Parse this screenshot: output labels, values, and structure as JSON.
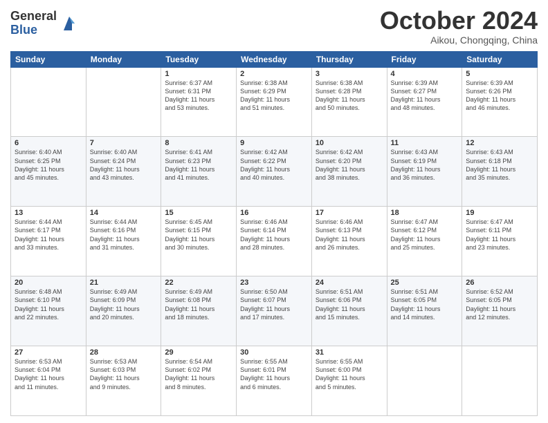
{
  "header": {
    "logo_line1": "General",
    "logo_line2": "Blue",
    "month_title": "October 2024",
    "location": "Aikou, Chongqing, China"
  },
  "calendar": {
    "weekdays": [
      "Sunday",
      "Monday",
      "Tuesday",
      "Wednesday",
      "Thursday",
      "Friday",
      "Saturday"
    ],
    "weeks": [
      [
        {
          "day": "",
          "info": ""
        },
        {
          "day": "",
          "info": ""
        },
        {
          "day": "1",
          "info": "Sunrise: 6:37 AM\nSunset: 6:31 PM\nDaylight: 11 hours\nand 53 minutes."
        },
        {
          "day": "2",
          "info": "Sunrise: 6:38 AM\nSunset: 6:29 PM\nDaylight: 11 hours\nand 51 minutes."
        },
        {
          "day": "3",
          "info": "Sunrise: 6:38 AM\nSunset: 6:28 PM\nDaylight: 11 hours\nand 50 minutes."
        },
        {
          "day": "4",
          "info": "Sunrise: 6:39 AM\nSunset: 6:27 PM\nDaylight: 11 hours\nand 48 minutes."
        },
        {
          "day": "5",
          "info": "Sunrise: 6:39 AM\nSunset: 6:26 PM\nDaylight: 11 hours\nand 46 minutes."
        }
      ],
      [
        {
          "day": "6",
          "info": "Sunrise: 6:40 AM\nSunset: 6:25 PM\nDaylight: 11 hours\nand 45 minutes."
        },
        {
          "day": "7",
          "info": "Sunrise: 6:40 AM\nSunset: 6:24 PM\nDaylight: 11 hours\nand 43 minutes."
        },
        {
          "day": "8",
          "info": "Sunrise: 6:41 AM\nSunset: 6:23 PM\nDaylight: 11 hours\nand 41 minutes."
        },
        {
          "day": "9",
          "info": "Sunrise: 6:42 AM\nSunset: 6:22 PM\nDaylight: 11 hours\nand 40 minutes."
        },
        {
          "day": "10",
          "info": "Sunrise: 6:42 AM\nSunset: 6:20 PM\nDaylight: 11 hours\nand 38 minutes."
        },
        {
          "day": "11",
          "info": "Sunrise: 6:43 AM\nSunset: 6:19 PM\nDaylight: 11 hours\nand 36 minutes."
        },
        {
          "day": "12",
          "info": "Sunrise: 6:43 AM\nSunset: 6:18 PM\nDaylight: 11 hours\nand 35 minutes."
        }
      ],
      [
        {
          "day": "13",
          "info": "Sunrise: 6:44 AM\nSunset: 6:17 PM\nDaylight: 11 hours\nand 33 minutes."
        },
        {
          "day": "14",
          "info": "Sunrise: 6:44 AM\nSunset: 6:16 PM\nDaylight: 11 hours\nand 31 minutes."
        },
        {
          "day": "15",
          "info": "Sunrise: 6:45 AM\nSunset: 6:15 PM\nDaylight: 11 hours\nand 30 minutes."
        },
        {
          "day": "16",
          "info": "Sunrise: 6:46 AM\nSunset: 6:14 PM\nDaylight: 11 hours\nand 28 minutes."
        },
        {
          "day": "17",
          "info": "Sunrise: 6:46 AM\nSunset: 6:13 PM\nDaylight: 11 hours\nand 26 minutes."
        },
        {
          "day": "18",
          "info": "Sunrise: 6:47 AM\nSunset: 6:12 PM\nDaylight: 11 hours\nand 25 minutes."
        },
        {
          "day": "19",
          "info": "Sunrise: 6:47 AM\nSunset: 6:11 PM\nDaylight: 11 hours\nand 23 minutes."
        }
      ],
      [
        {
          "day": "20",
          "info": "Sunrise: 6:48 AM\nSunset: 6:10 PM\nDaylight: 11 hours\nand 22 minutes."
        },
        {
          "day": "21",
          "info": "Sunrise: 6:49 AM\nSunset: 6:09 PM\nDaylight: 11 hours\nand 20 minutes."
        },
        {
          "day": "22",
          "info": "Sunrise: 6:49 AM\nSunset: 6:08 PM\nDaylight: 11 hours\nand 18 minutes."
        },
        {
          "day": "23",
          "info": "Sunrise: 6:50 AM\nSunset: 6:07 PM\nDaylight: 11 hours\nand 17 minutes."
        },
        {
          "day": "24",
          "info": "Sunrise: 6:51 AM\nSunset: 6:06 PM\nDaylight: 11 hours\nand 15 minutes."
        },
        {
          "day": "25",
          "info": "Sunrise: 6:51 AM\nSunset: 6:05 PM\nDaylight: 11 hours\nand 14 minutes."
        },
        {
          "day": "26",
          "info": "Sunrise: 6:52 AM\nSunset: 6:05 PM\nDaylight: 11 hours\nand 12 minutes."
        }
      ],
      [
        {
          "day": "27",
          "info": "Sunrise: 6:53 AM\nSunset: 6:04 PM\nDaylight: 11 hours\nand 11 minutes."
        },
        {
          "day": "28",
          "info": "Sunrise: 6:53 AM\nSunset: 6:03 PM\nDaylight: 11 hours\nand 9 minutes."
        },
        {
          "day": "29",
          "info": "Sunrise: 6:54 AM\nSunset: 6:02 PM\nDaylight: 11 hours\nand 8 minutes."
        },
        {
          "day": "30",
          "info": "Sunrise: 6:55 AM\nSunset: 6:01 PM\nDaylight: 11 hours\nand 6 minutes."
        },
        {
          "day": "31",
          "info": "Sunrise: 6:55 AM\nSunset: 6:00 PM\nDaylight: 11 hours\nand 5 minutes."
        },
        {
          "day": "",
          "info": ""
        },
        {
          "day": "",
          "info": ""
        }
      ]
    ]
  }
}
